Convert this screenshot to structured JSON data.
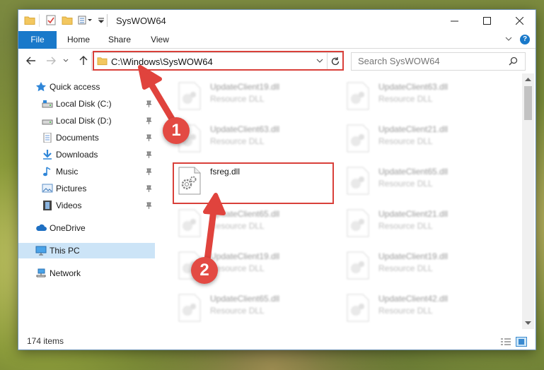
{
  "window": {
    "title": "SysWOW64"
  },
  "ribbon": {
    "tabs": [
      "File",
      "Home",
      "Share",
      "View"
    ]
  },
  "address": {
    "path": "C:\\Windows\\SysWOW64",
    "search_placeholder": "Search SysWOW64"
  },
  "nav_pane": {
    "quick_access": "Quick access",
    "items": [
      "Local Disk (C:)",
      "Local Disk (D:)",
      "Documents",
      "Downloads",
      "Music",
      "Pictures",
      "Videos"
    ],
    "onedrive": "OneDrive",
    "this_pc": "This PC",
    "network": "Network"
  },
  "files": [
    {
      "name": "UpdateClient19.dll",
      "type": "Resource DLL"
    },
    {
      "name": "UpdateClient63.dll",
      "type": "Resource DLL"
    },
    {
      "name": "UpdateClient63.dll",
      "type": "Resource DLL"
    },
    {
      "name": "UpdateClient21.dll",
      "type": "Resource DLL"
    },
    {
      "name": "fsreg.dll",
      "type": ""
    },
    {
      "name": "UpdateClient65.dll",
      "type": "Resource DLL"
    },
    {
      "name": "UpdateClient65.dll",
      "type": "Resource DLL"
    },
    {
      "name": "UpdateClient21.dll",
      "type": "Resource DLL"
    },
    {
      "name": "UpdateClient19.dll",
      "type": "Resource DLL"
    },
    {
      "name": "UpdateClient19.dll",
      "type": "Resource DLL"
    },
    {
      "name": "UpdateClient65.dll",
      "type": "Resource DLL"
    },
    {
      "name": "UpdateClient42.dll",
      "type": "Resource DLL"
    }
  ],
  "status": {
    "item_count": "174 items"
  },
  "annotations": {
    "step1": "1",
    "step2": "2",
    "color": "#d9403a"
  }
}
